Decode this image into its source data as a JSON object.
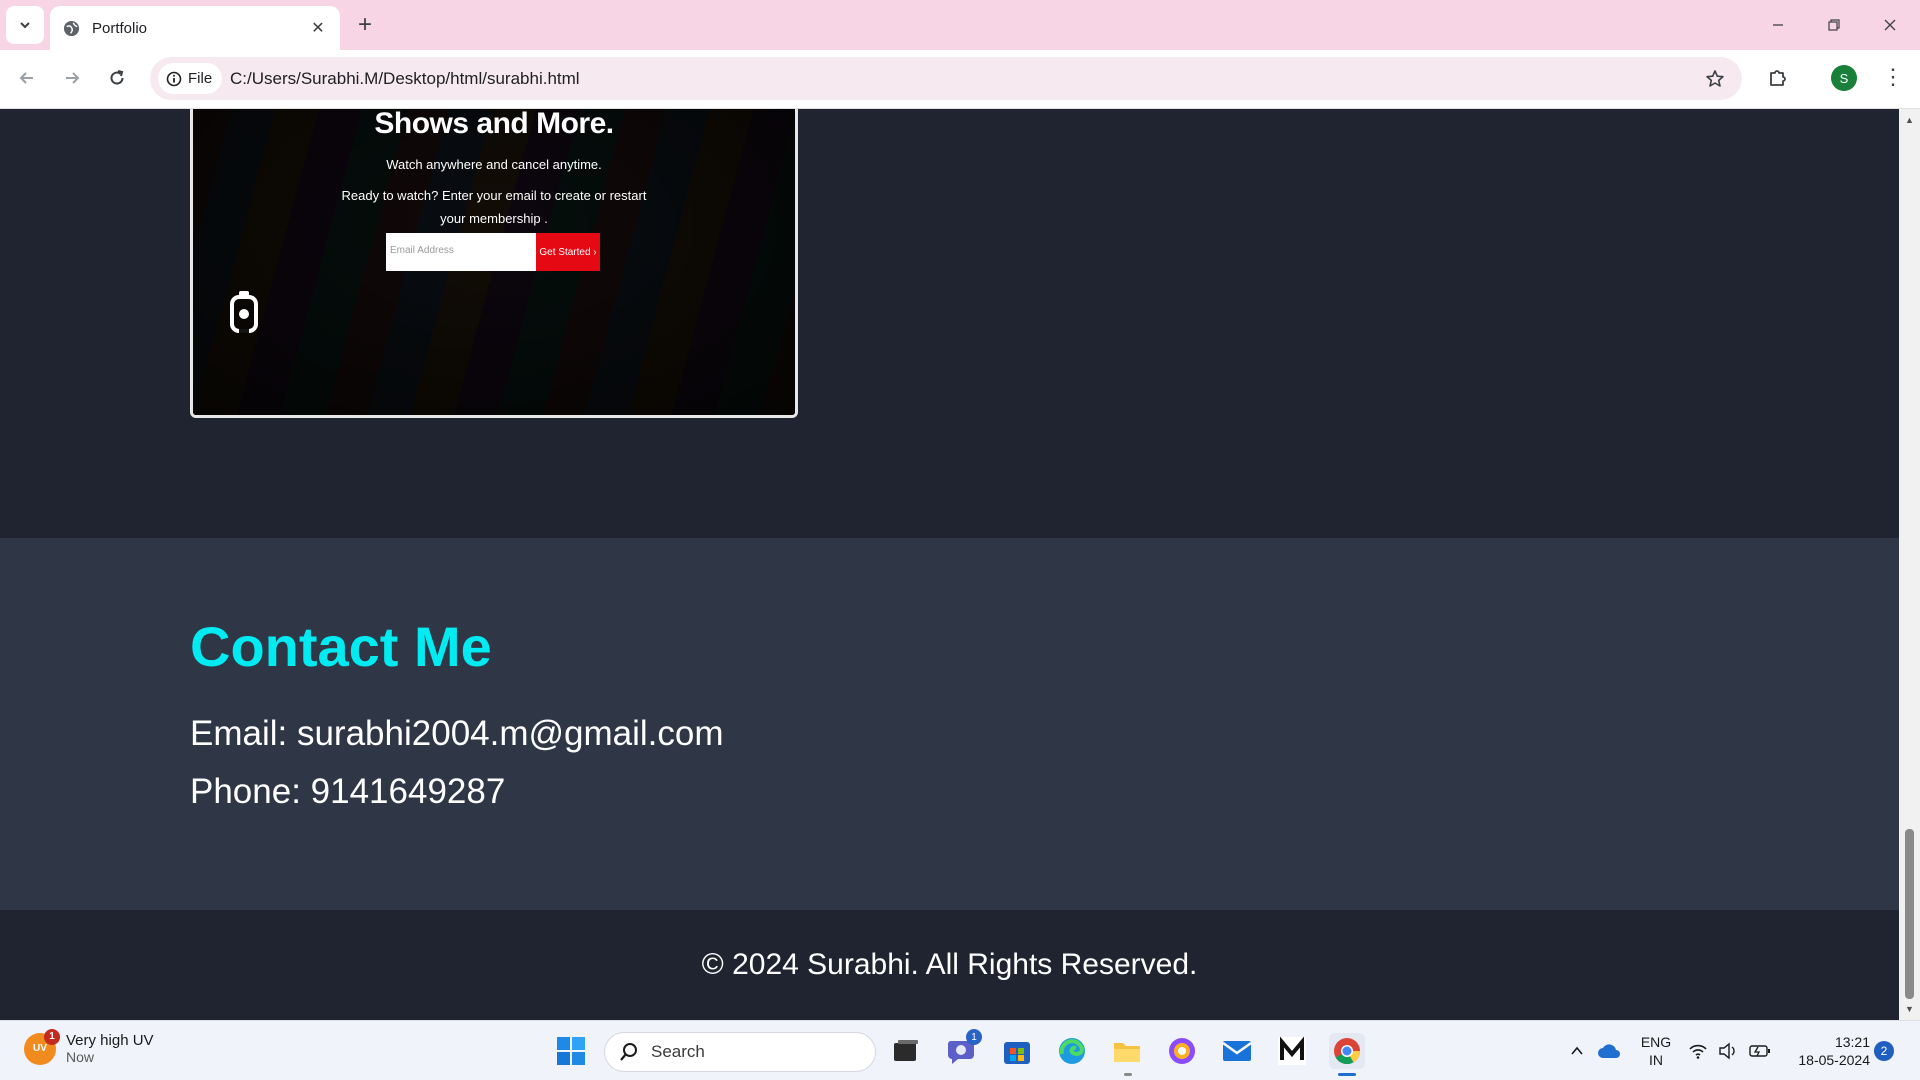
{
  "browser": {
    "tab": {
      "title": "Portfolio"
    },
    "new_tab_symbol": "+",
    "close_symbol": "✕",
    "address": {
      "chip_label": "File",
      "url": "C:/Users/Surabhi.M/Desktop/html/surabhi.html"
    },
    "profile_initial": "S"
  },
  "page": {
    "project_preview": {
      "heading": "Shows and More.",
      "line1": "Watch anywhere and cancel anytime.",
      "line2": "Ready to watch? Enter your email to create or restart",
      "line3": "your membership .",
      "email_placeholder": "Email Address",
      "cta_label": "Get Started ›"
    },
    "contact": {
      "title": "Contact Me",
      "email": "Email: surabhi2004.m@gmail.com",
      "phone": "Phone: 9141649287"
    },
    "footer": {
      "text": "© 2024 Surabhi. All Rights Reserved."
    }
  },
  "taskbar": {
    "weather": {
      "badge": "UV",
      "notification_count": "1",
      "title": "Very high UV",
      "subtitle": "Now"
    },
    "search_label": "Search",
    "teams_badge": "1",
    "language": {
      "line1": "ENG",
      "line2": "IN"
    },
    "clock": {
      "time": "13:21",
      "date": "18-05-2024"
    },
    "notification_count": "2"
  },
  "colors": {
    "tabstrip": "#f8d5e5",
    "page_bg": "#1f2430",
    "contact_bg": "#2f3747",
    "accent": "#00ecf2",
    "cta_red": "#e50914"
  }
}
